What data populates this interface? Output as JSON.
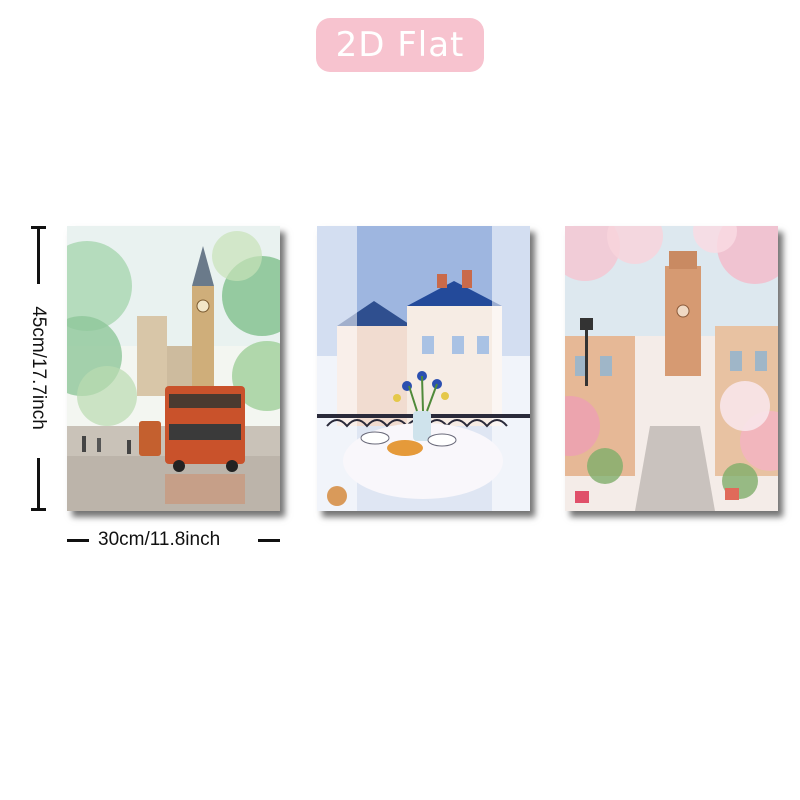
{
  "badge": {
    "label": "2D Flat",
    "color": "#f7c3cf"
  },
  "dimensions": {
    "height_label": "45cm/17.7inch",
    "width_label": "30cm/11.8inch"
  },
  "panels": [
    {
      "subject": "london-big-ben-double-decker-bus"
    },
    {
      "subject": "paris-balcony-breakfast-flowers"
    },
    {
      "subject": "cherry-blossom-street-tower"
    }
  ]
}
